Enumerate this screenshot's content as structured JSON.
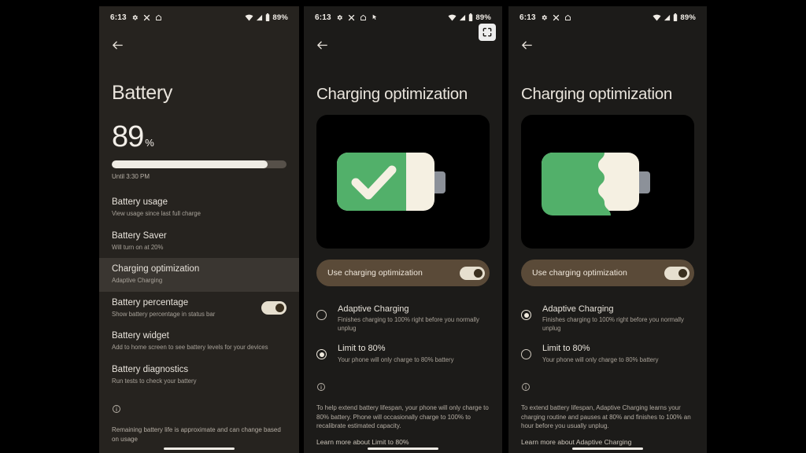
{
  "statusbar": {
    "time": "6:13",
    "battery_pct": "89%",
    "icons_left": [
      "settings-gear-icon",
      "x-icon",
      "home-outline-icon"
    ],
    "icons_left_extra": [
      "cursor-icon"
    ],
    "icons_right": [
      "wifi-icon",
      "signal-icon",
      "battery-icon"
    ]
  },
  "panel1": {
    "name": "battery-settings-screen",
    "back_icon": "back-arrow-icon",
    "title": "Battery",
    "level": "89",
    "level_unit": "%",
    "level_fill_percent": 89,
    "until": "Until 3:30 PM",
    "rows": [
      {
        "title": "Battery usage",
        "sub": "View usage since last full charge",
        "selected": false,
        "toggle": null
      },
      {
        "title": "Battery Saver",
        "sub": "Will turn on at 20%",
        "selected": false,
        "toggle": null
      },
      {
        "title": "Charging optimization",
        "sub": "Adaptive Charging",
        "selected": true,
        "toggle": null
      },
      {
        "title": "Battery percentage",
        "sub": "Show battery percentage in status bar",
        "selected": false,
        "toggle": "on"
      },
      {
        "title": "Battery widget",
        "sub": "Add to home screen to see battery levels for your devices",
        "selected": false,
        "toggle": null
      },
      {
        "title": "Battery diagnostics",
        "sub": "Run tests to check your battery",
        "selected": false,
        "toggle": null
      }
    ],
    "footer_icon": "info-icon",
    "footer_note": "Remaining battery life is approximate and can change based on usage"
  },
  "panel2": {
    "name": "charging-optimization-limit80-screen",
    "back_icon": "back-arrow-icon",
    "title": "Charging optimization",
    "screenshot_badge_icon": "screenshot-capture-icon",
    "art": {
      "type": "battery-check",
      "fill_percent": 72,
      "icon": "check-icon"
    },
    "toggle_label": "Use charging optimization",
    "toggle_state": "on",
    "options": [
      {
        "title": "Adaptive Charging",
        "sub": "Finishes charging to 100% right before you normally unplug",
        "selected": false
      },
      {
        "title": "Limit to 80%",
        "sub": "Your phone will only charge to 80% battery",
        "selected": true
      }
    ],
    "footer_icon": "info-icon",
    "footer_note": "To help extend battery lifespan, your phone will only charge to 80% battery. Phone will occasionally charge to 100% to recalibrate estimated capacity.",
    "footer_link": "Learn more about Limit to 80%"
  },
  "panel3": {
    "name": "charging-optimization-adaptive-screen",
    "back_icon": "back-arrow-icon",
    "title": "Charging optimization",
    "art": {
      "type": "battery-wavy",
      "fill_percent": 64
    },
    "toggle_label": "Use charging optimization",
    "toggle_state": "on",
    "options": [
      {
        "title": "Adaptive Charging",
        "sub": "Finishes charging to 100% right before you normally unplug",
        "selected": true
      },
      {
        "title": "Limit to 80%",
        "sub": "Your phone will only charge to 80% battery",
        "selected": false
      }
    ],
    "footer_icon": "info-icon",
    "footer_note": "To extend battery lifespan, Adaptive Charging learns your charging routine and pauses at 80% and finishes to 100% an hour before you usually unplug.",
    "footer_link": "Learn more about Adaptive Charging"
  },
  "colors": {
    "background": "#000000",
    "panel_bg": "#26231f",
    "panel_bg_dark": "#1c1b19",
    "selected_row": "#3a3631",
    "toggle_card": "#5a4a38",
    "battery_green": "#52b06a",
    "battery_cream": "#f5f0e2",
    "battery_cap": "#8c9199",
    "text_primary": "#e9e4dc",
    "text_secondary": "#a8a299"
  }
}
